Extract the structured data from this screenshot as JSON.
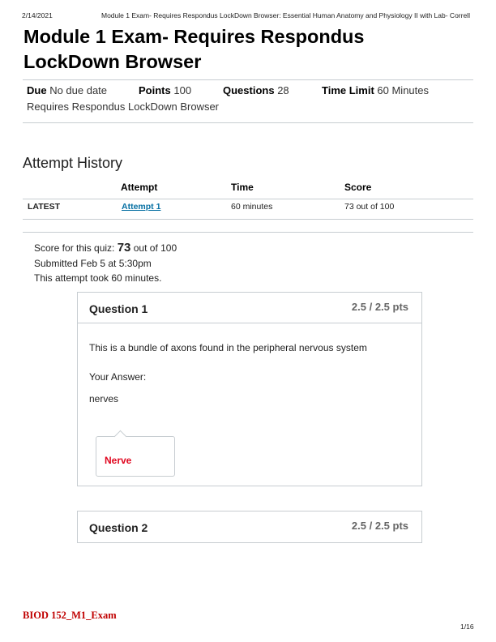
{
  "print_header": {
    "date": "2/14/2021",
    "title": "Module 1 Exam- Requires Respondus LockDown Browser: Essential Human Anatomy and Physiology II with Lab- Correll"
  },
  "quiz": {
    "title": "Module 1 Exam- Requires Respondus LockDown Browser",
    "due_label": "Due",
    "due_value": "No due date",
    "points_label": "Points",
    "points_value": "100",
    "questions_label": "Questions",
    "questions_value": "28",
    "time_limit_label": "Time Limit",
    "time_limit_value": "60 Minutes",
    "lockdown_note": "Requires Respondus LockDown Browser"
  },
  "attempt_history": {
    "title": "Attempt History",
    "headers": [
      "Attempt",
      "Time",
      "Score"
    ],
    "rows": [
      {
        "label": "LATEST",
        "attempt": "Attempt 1",
        "time": "60 minutes",
        "score": "73 out of 100"
      }
    ]
  },
  "result": {
    "score_prefix": "Score for this quiz:",
    "score": "73",
    "score_suffix": "out of 100",
    "submitted": "Submitted Feb 5 at 5:30pm",
    "duration": "This attempt took 60 minutes."
  },
  "questions": [
    {
      "name": "Question 1",
      "points": "2.5 / 2.5 pts",
      "text": "This is a bundle of axons found in the peripheral nervous system",
      "answer_label": "Your Answer:",
      "answer": "nerves",
      "correct_answer": "Nerve"
    },
    {
      "name": "Question 2",
      "points": "2.5 / 2.5 pts"
    }
  ],
  "footer": {
    "course": "BIOD 152_M1_Exam",
    "page": "1/16"
  }
}
